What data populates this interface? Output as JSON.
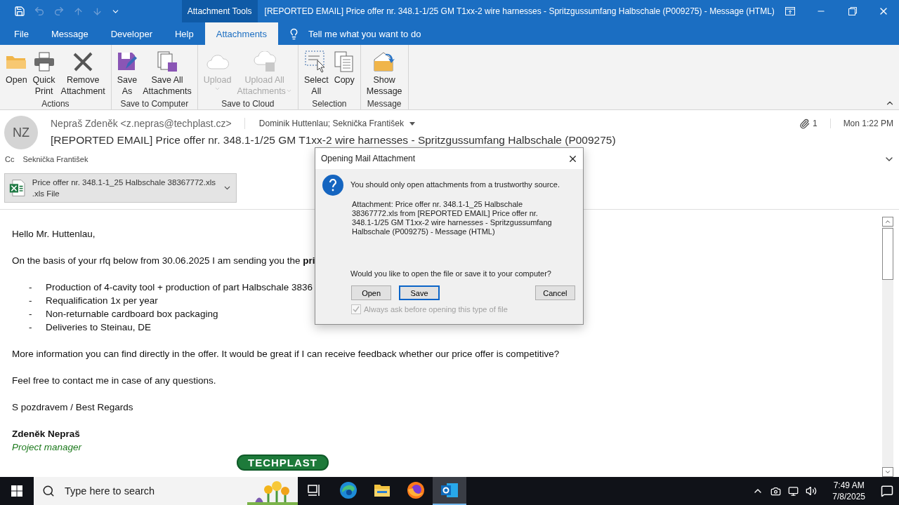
{
  "window": {
    "context_label": "Attachment Tools",
    "title": "[REPORTED EMAIL] Price offer nr. 348.1-1/25 GM T1xx-2 wire harnesses - Spritzgussumfang Halbschale (P009275)  -  Message (HTML)"
  },
  "menu_tabs": [
    {
      "label": "File",
      "selected": false
    },
    {
      "label": "Message",
      "selected": false
    },
    {
      "label": "Developer",
      "selected": false
    },
    {
      "label": "Help",
      "selected": false
    },
    {
      "label": "Attachments",
      "selected": true
    }
  ],
  "tell_me": "Tell me what you want to do",
  "ribbon_groups": [
    {
      "label": "Actions",
      "buttons": [
        {
          "kind": "folder",
          "lines": [
            "Open"
          ],
          "disabled": false
        },
        {
          "kind": "printer",
          "lines": [
            "Quick",
            "Print"
          ],
          "disabled": false
        },
        {
          "kind": "remove",
          "lines": [
            "Remove",
            "Attachment"
          ],
          "disabled": false
        }
      ]
    },
    {
      "label": "Save to Computer",
      "buttons": [
        {
          "kind": "save",
          "lines": [
            "Save",
            "As"
          ],
          "disabled": false
        },
        {
          "kind": "saveall",
          "lines": [
            "Save All",
            "Attachments"
          ],
          "disabled": false
        }
      ]
    },
    {
      "label": "Save to Cloud",
      "buttons": [
        {
          "kind": "cloud",
          "lines": [
            "Upload"
          ],
          "disabled": true,
          "dropdown": true
        },
        {
          "kind": "cloudsave",
          "lines": [
            "Upload All",
            "Attachments"
          ],
          "disabled": true,
          "dropdown": true
        }
      ]
    },
    {
      "label": "Selection",
      "buttons": [
        {
          "kind": "select",
          "lines": [
            "Select",
            "All"
          ],
          "disabled": false
        },
        {
          "kind": "copy",
          "lines": [
            "Copy"
          ],
          "disabled": false
        }
      ]
    },
    {
      "label": "Message",
      "buttons": [
        {
          "kind": "envelope",
          "lines": [
            "Show",
            "Message"
          ],
          "disabled": false
        }
      ]
    }
  ],
  "message": {
    "avatar": "NZ",
    "from": "Nepraš Zdeněk <z.nepras@techplast.cz>",
    "to": "Dominik Huttenlau; Seknička František",
    "attachment_count": "1",
    "date": "Mon 1:22 PM",
    "subject": "[REPORTED EMAIL] Price offer nr. 348.1-1/25 GM T1xx-2 wire harnesses - Spritzgussumfang Halbschale (P009275)",
    "cc_label": "Cc",
    "cc": "Seknička František",
    "attachment": {
      "name": "Price offer nr. 348.1-1_25 Halbschale 38367772.xls",
      "type": ".xls File"
    }
  },
  "body": [
    {
      "kind": "para",
      "text": "Hello Mr. Huttenlau,"
    },
    {
      "kind": "para",
      "text": "On the basis of your rfq below from 30.06.2025 I am sending you the **pri**"
    },
    {
      "kind": "bullets",
      "items": [
        {
          "marker": "-",
          "text": "Production of 4-cavity tool + production of part Halbschale 3836"
        },
        {
          "marker": "-",
          "text": "Requalification 1x per year"
        },
        {
          "marker": "-",
          "text": "Non-returnable cardboard box packaging"
        },
        {
          "marker": "-",
          "text": "Deliveries to Steinau, DE"
        }
      ]
    },
    {
      "kind": "para",
      "text": "More information you can find directly in the offer. It would be great if I can receive feedback whether our price offer is competitive?"
    },
    {
      "kind": "para",
      "text": "Feel free to contact me in case of any questions."
    },
    {
      "kind": "para",
      "text": "S pozdravem / Best Regards"
    },
    {
      "kind": "name",
      "text": "Zdeněk Nepraš"
    },
    {
      "kind": "role",
      "text": "Project manager"
    },
    {
      "kind": "logo",
      "text": "TECHPLAST"
    }
  ],
  "dialog": {
    "title": "Opening Mail Attachment",
    "warning": "You should only open attachments from a trustworthy source.",
    "details": "Attachment: Price offer nr. 348.1-1_25 Halbschale 38367772.xls from [REPORTED EMAIL] Price offer nr. 348.1-1/25 GM T1xx-2 wire harnesses - Spritzgussumfang Halbschale (P009275) - Message (HTML)",
    "question": "Would you like to open the file or save it to your computer?",
    "buttons": [
      {
        "label": "Open",
        "selected": false
      },
      {
        "label": "Save",
        "selected": true
      },
      {
        "label": "Cancel",
        "selected": false
      }
    ],
    "checkbox": {
      "label": "Always ask before opening this type of file",
      "checked": true,
      "disabled": true
    }
  },
  "taskbar": {
    "search_placeholder": "Type here to search",
    "apps": [
      {
        "kind": "taskview",
        "selected": false
      },
      {
        "kind": "edge",
        "selected": false
      },
      {
        "kind": "explorer",
        "selected": false
      },
      {
        "kind": "firefox",
        "selected": false
      },
      {
        "kind": "outlook",
        "selected": true
      }
    ],
    "time": "7:49 AM",
    "date": "7/8/2025"
  }
}
